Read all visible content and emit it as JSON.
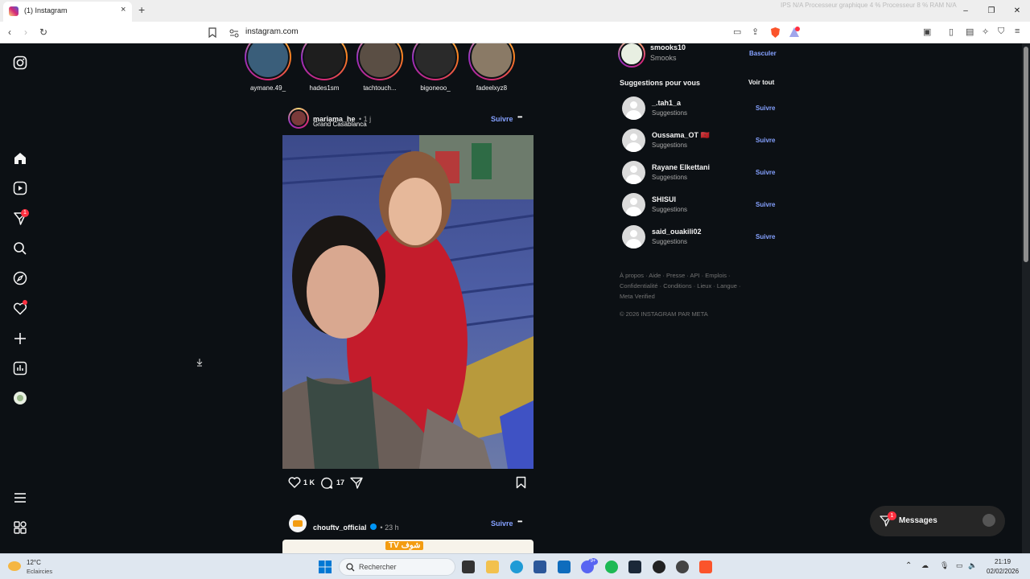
{
  "browser": {
    "tab_title": "(1) Instagram",
    "tab_close": "×",
    "new_tab": "+",
    "url": "instagram.com",
    "system_monitor": "IPS  N/A     Processeur graphique  4 %    Processeur  8 %    RAM  N/A",
    "window_controls": {
      "minimize": "–",
      "maximize": "❐",
      "close": "✕"
    }
  },
  "stories": [
    {
      "username": "aymane.49_",
      "color": "#3a5e7a"
    },
    {
      "username": "hades1sm",
      "color": "#1e1e1e"
    },
    {
      "username": "tachtouch...",
      "color": "#5a4e44"
    },
    {
      "username": "bigoneoo_",
      "color": "#2a2a2a"
    },
    {
      "username": "fadeelxyz8",
      "color": "#8a7a66"
    }
  ],
  "post1": {
    "username": "mariama_he",
    "time": "• 1 j",
    "location": "Grand Casablanca",
    "follow": "Suivre",
    "more": "•••",
    "likes": "1 K",
    "comments": "17"
  },
  "post2": {
    "username": "chouftv_official",
    "time": "• 23 h",
    "follow": "Suivre",
    "more": "•••",
    "preview_text": "TV شوف"
  },
  "sidebar": {
    "account_username": "smooks10",
    "account_name": "Smooks",
    "switch": "Basculer",
    "suggestions_title": "Suggestions pour vous",
    "see_all": "Voir tout",
    "suggestions": [
      {
        "name": "_.tah1_a",
        "sub": "Suggestions",
        "follow": "Suivre"
      },
      {
        "name": "Oussama_OT 🇲🇦",
        "sub": "Suggestions",
        "follow": "Suivre"
      },
      {
        "name": "Rayane Elkettani",
        "sub": "Suggestions",
        "follow": "Suivre"
      },
      {
        "name": "SHISUI",
        "sub": "Suggestions",
        "follow": "Suivre"
      },
      {
        "name": "said_ouakili02",
        "sub": "Suggestions",
        "follow": "Suivre"
      }
    ],
    "footer_links": "À propos · Aide · Presse · API · Emplois · Confidentialité · Conditions · Lieux · Langue · Meta Verified",
    "copyright": "© 2026 INSTAGRAM PAR META"
  },
  "nav_badges": {
    "messages": "1"
  },
  "messages_pill": {
    "label": "Messages",
    "badge": "1"
  },
  "taskbar": {
    "weather_temp": "12°C",
    "weather_desc": "Eclaircies",
    "search_placeholder": "Rechercher",
    "time": "21:19",
    "date": "02/02/2026",
    "discord_badge": "9+"
  },
  "colors": {
    "background": "#0c1014",
    "link_blue": "#85a1ff",
    "notification_red": "#ff3040"
  }
}
